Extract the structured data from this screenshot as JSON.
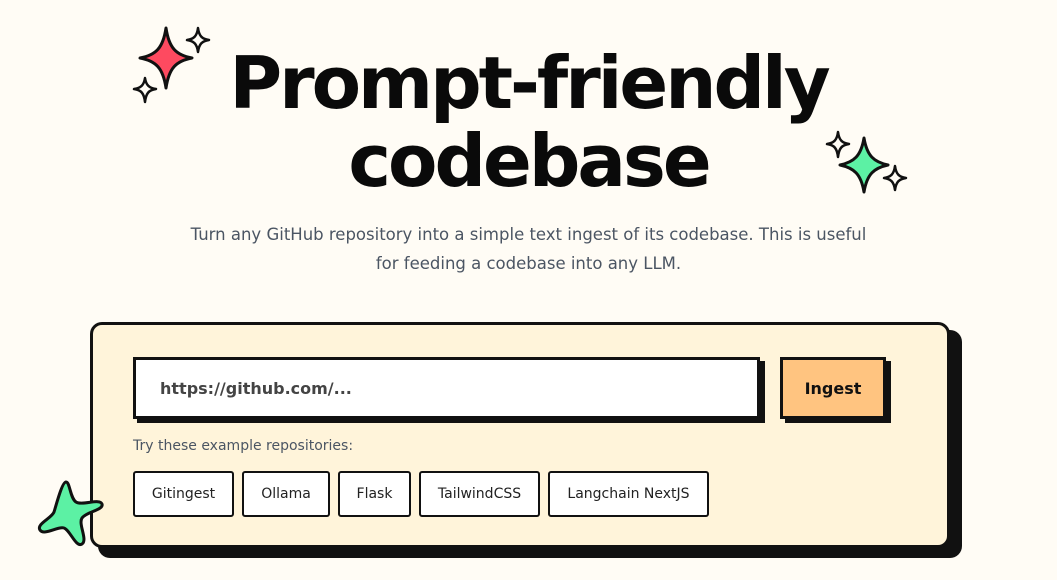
{
  "hero": {
    "title_line1": "Prompt-friendly",
    "title_line2": "codebase",
    "subtitle": "Turn any GitHub repository into a simple text ingest of its codebase. This is useful for feeding a codebase into any LLM."
  },
  "form": {
    "url_placeholder": "https://github.com/...",
    "url_value": "",
    "submit_label": "Ingest",
    "examples_label": "Try these example repositories:",
    "examples": [
      "Gitingest",
      "Ollama",
      "Flask",
      "TailwindCSS",
      "Langchain NextJS"
    ]
  },
  "colors": {
    "background": "#fffcf5",
    "card_background": "#fff4da",
    "button_accent": "#ffc480",
    "sparkle_red": "#fe4a60",
    "sparkle_green": "#5cf1a4",
    "border": "#111111"
  },
  "icons": [
    "sparkle-red-icon",
    "sparkle-green-icon",
    "sparkle-outline-icon",
    "star-green-icon"
  ]
}
